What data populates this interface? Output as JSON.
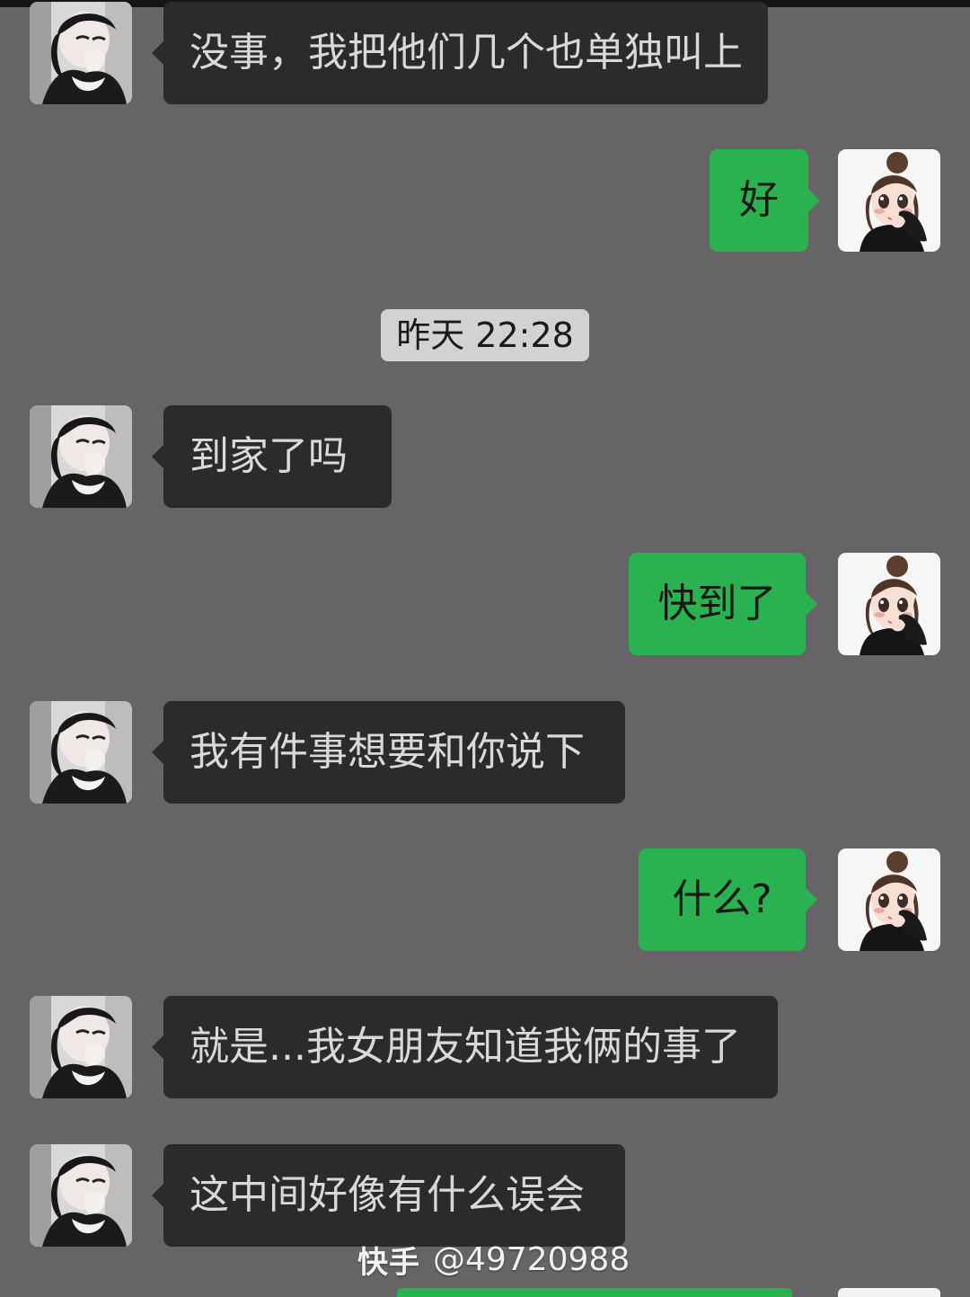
{
  "app": {
    "name": "chat"
  },
  "chat": {
    "timestamp": "昨天 22:28",
    "messages": [
      {
        "sender": "other",
        "text": "没事，我把他们几个也单独叫上"
      },
      {
        "sender": "self",
        "text": "好"
      },
      {
        "sender": "other",
        "text": "到家了吗"
      },
      {
        "sender": "self",
        "text": "快到了"
      },
      {
        "sender": "other",
        "text": "我有件事想要和你说下"
      },
      {
        "sender": "self",
        "text": "什么?"
      },
      {
        "sender": "other",
        "text": "就是...我女朋友知道我俩的事了"
      },
      {
        "sender": "other",
        "text": "这中间好像有什么误会"
      }
    ]
  },
  "watermark": {
    "brand": "快手",
    "handle": "@49720988"
  },
  "colors": {
    "background": "#676467",
    "incoming_bubble": "#2b2b2b",
    "outgoing_bubble": "#2ab251",
    "timestamp_pill": "#d3d1d3"
  }
}
